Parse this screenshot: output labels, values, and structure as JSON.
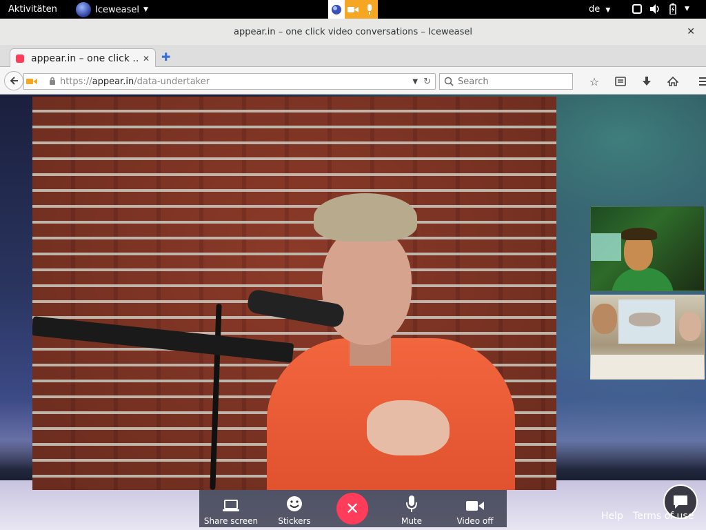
{
  "topbar": {
    "activities": "Aktivitäten",
    "app_name": "Iceweasel",
    "language": "de"
  },
  "window": {
    "title": "appear.in – one click video conversations – Iceweasel"
  },
  "tabs": [
    {
      "label": "appear.in – one click ..."
    }
  ],
  "navbar": {
    "url_prefix": "https://",
    "url_host": "appear.in",
    "url_path": "/data-undertaker",
    "search_placeholder": "Search"
  },
  "controls": {
    "share_screen": "Share screen",
    "stickers": "Stickers",
    "mute": "Mute",
    "video_off": "Video off"
  },
  "footer": {
    "help": "Help",
    "terms": "Terms of use"
  },
  "colors": {
    "hangup": "#ff3c5a",
    "indicator_orange": "#f5a623"
  },
  "icons": {
    "topbar": [
      "globe-icon",
      "camera-indicator-icon",
      "microphone-indicator-icon",
      "window-icon",
      "volume-icon",
      "battery-icon",
      "chevron-down-icon"
    ],
    "toolbar": [
      "back-icon",
      "lock-icon",
      "reload-icon",
      "search-icon",
      "star-icon",
      "reading-list-icon",
      "download-icon",
      "home-icon",
      "menu-icon"
    ],
    "controls": [
      "laptop-icon",
      "smiley-icon",
      "close-icon",
      "microphone-icon",
      "video-camera-icon",
      "chat-icon"
    ]
  }
}
